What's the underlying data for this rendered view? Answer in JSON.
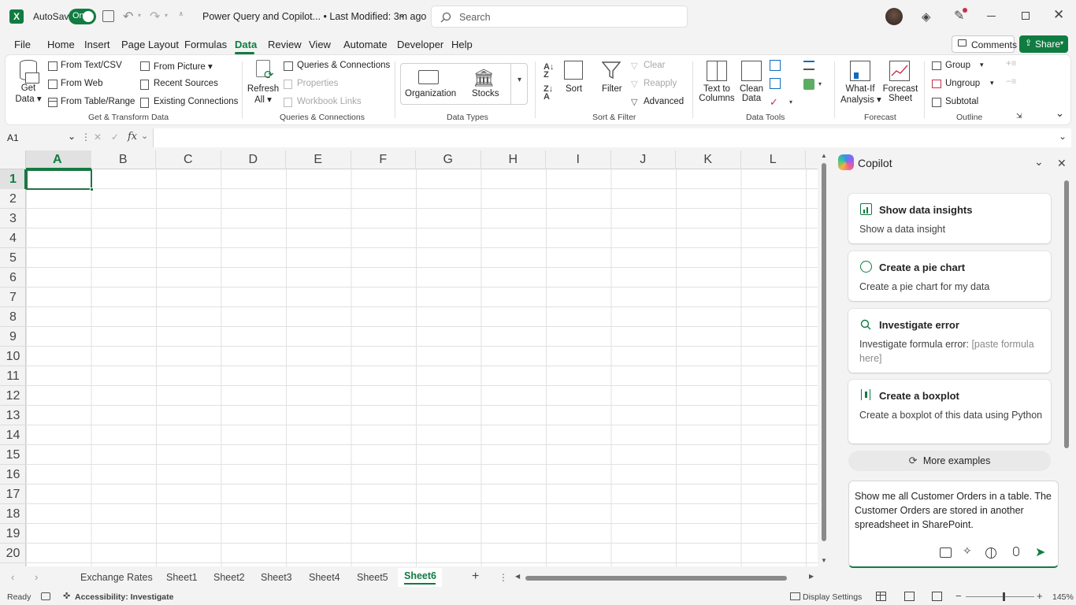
{
  "titlebar": {
    "autosave_label": "AutoSave",
    "autosave_state": "On",
    "title": "Power Query and Copilot... • Last Modified: 3m ago",
    "search_placeholder": "Search"
  },
  "menu": [
    "File",
    "Home",
    "Insert",
    "Page Layout",
    "Formulas",
    "Data",
    "Review",
    "View",
    "Automate",
    "Developer",
    "Help"
  ],
  "menu_active": "Data",
  "actions": {
    "comments": "Comments",
    "share": "Share"
  },
  "ribbon": {
    "get_data": [
      "Get",
      "Data"
    ],
    "from_text_csv": "From Text/CSV",
    "from_web": "From Web",
    "from_table_range": "From Table/Range",
    "from_picture": "From Picture",
    "recent_sources": "Recent Sources",
    "existing_connections": "Existing Connections",
    "group_get_transform": "Get & Transform Data",
    "refresh_all": [
      "Refresh",
      "All"
    ],
    "queries_connections": "Queries & Connections",
    "properties": "Properties",
    "workbook_links": "Workbook Links",
    "group_queries": "Queries & Connections",
    "organization": "Organization",
    "stocks": "Stocks",
    "group_data_types": "Data Types",
    "sort": "Sort",
    "filter": "Filter",
    "clear": "Clear",
    "reapply": "Reapply",
    "advanced": "Advanced",
    "group_sort_filter": "Sort & Filter",
    "text_to_columns": [
      "Text to",
      "Columns"
    ],
    "clean_data": [
      "Clean",
      "Data"
    ],
    "group_data_tools": "Data Tools",
    "what_if": [
      "What-If",
      "Analysis"
    ],
    "forecast_sheet": [
      "Forecast",
      "Sheet"
    ],
    "group_forecast": "Forecast",
    "group_btn": "Group",
    "ungroup": "Ungroup",
    "subtotal": "Subtotal",
    "group_outline": "Outline"
  },
  "formula_bar": {
    "name_box": "A1",
    "fx": "fx"
  },
  "grid": {
    "columns": [
      "A",
      "B",
      "C",
      "D",
      "E",
      "F",
      "G",
      "H",
      "I",
      "J",
      "K",
      "L"
    ],
    "rows": [
      "1",
      "2",
      "3",
      "4",
      "5",
      "6",
      "7",
      "8",
      "9",
      "10",
      "11",
      "12",
      "13",
      "14",
      "15",
      "16",
      "17",
      "18",
      "19",
      "20"
    ],
    "selected_cell": "A1"
  },
  "copilot": {
    "title": "Copilot",
    "cards": [
      {
        "title": "Show data insights",
        "desc": "Show a data insight",
        "icon": "insights-icon"
      },
      {
        "title": "Create a pie chart",
        "desc": "Create a pie chart for my data",
        "icon": "pie-chart-icon"
      },
      {
        "title": "Investigate error",
        "desc": "Investigate formula error:",
        "desc_placeholder": "[paste formula here]",
        "icon": "search-icon"
      },
      {
        "title": "Create a boxplot",
        "desc": "Create a boxplot of this data using Python",
        "icon": "boxplot-icon"
      }
    ],
    "more_examples": "More examples",
    "prompt": "Show me all Customer Orders in a table. The Customer Orders are stored in another spreadsheet in SharePoint."
  },
  "sheet_tabs": [
    "Exchange Rates",
    "Sheet1",
    "Sheet2",
    "Sheet3",
    "Sheet4",
    "Sheet5",
    "Sheet6"
  ],
  "active_sheet": "Sheet6",
  "status": {
    "ready": "Ready",
    "accessibility": "Accessibility: Investigate",
    "display_settings": "Display Settings",
    "zoom": "145%"
  },
  "colors": {
    "excel_green": "#107c41",
    "accent_blue": "#0f6cbd",
    "selection_green": "#217346"
  }
}
